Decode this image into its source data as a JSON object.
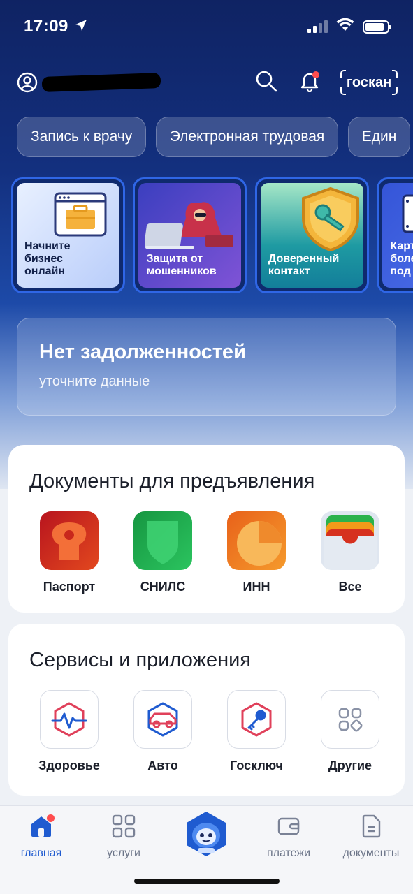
{
  "status_bar": {
    "time": "17:09"
  },
  "header": {
    "scan_label": "госкан"
  },
  "quick_chips": [
    {
      "label": "Запись к врачу"
    },
    {
      "label": "Электронная трудовая"
    },
    {
      "label": "Един"
    }
  ],
  "stories": [
    {
      "label": "Начните\nбизнес\nонлайн"
    },
    {
      "label": "Защита от\nмошенников"
    },
    {
      "label": "Доверенный\nконтакт"
    },
    {
      "label": "Карта\nболе\nпод р"
    }
  ],
  "debt_card": {
    "title": "Нет задолженностей",
    "subtitle": "уточните данные"
  },
  "documents": {
    "title": "Документы для предъявления",
    "items": [
      {
        "label": "Паспорт",
        "color": "#d63a1a"
      },
      {
        "label": "СНИЛС",
        "color": "#1ea94e"
      },
      {
        "label": "ИНН",
        "color": "#f07a1c"
      },
      {
        "label": "Все",
        "color": "#dfe6f0"
      }
    ]
  },
  "services": {
    "title": "Сервисы и приложения",
    "items": [
      {
        "label": "Здоровье",
        "icon": "health-icon"
      },
      {
        "label": "Авто",
        "icon": "car-icon"
      },
      {
        "label": "Госключ",
        "icon": "key-icon"
      },
      {
        "label": "Другие",
        "icon": "grid-icon"
      }
    ]
  },
  "tabbar": {
    "items": [
      {
        "label": "главная",
        "icon": "home-icon",
        "active": true
      },
      {
        "label": "услуги",
        "icon": "grid-icon"
      },
      {
        "label": "платежи",
        "icon": "wallet-icon"
      },
      {
        "label": "документы",
        "icon": "document-icon"
      }
    ]
  },
  "colors": {
    "accent": "#1f5bd0",
    "hero_dark": "#0f2363",
    "notification": "#ff4d4f"
  }
}
